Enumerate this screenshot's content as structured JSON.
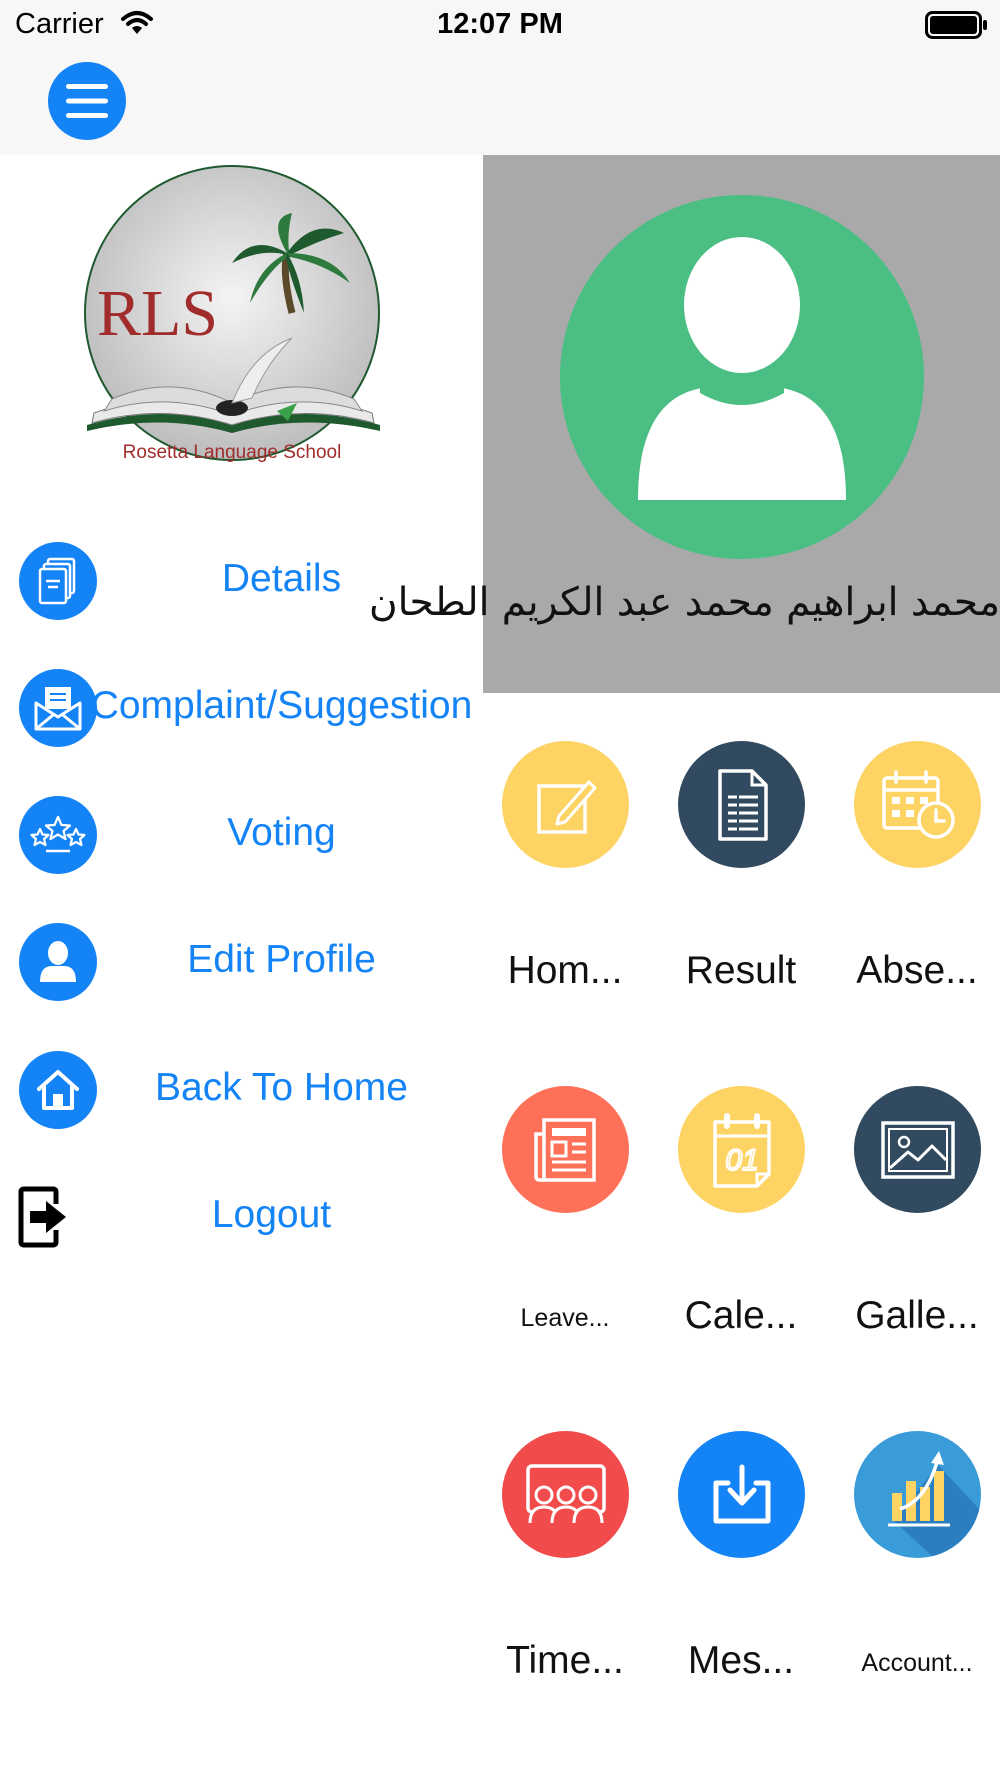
{
  "status_bar": {
    "carrier": "Carrier",
    "time": "12:07 PM"
  },
  "nav": {
    "menu_icon": "hamburger-menu-icon"
  },
  "drawer": {
    "logo": {
      "text_main": "RLS",
      "text_sub": "Rosetta Language School"
    },
    "items": [
      {
        "label": "Details",
        "icon": "document-stack-icon"
      },
      {
        "label": "Complaint/Suggestion",
        "icon": "envelope-icon"
      },
      {
        "label": "Voting",
        "icon": "stars-icon"
      },
      {
        "label": "Edit Profile",
        "icon": "person-icon"
      },
      {
        "label": "Back To Home",
        "icon": "home-icon"
      },
      {
        "label": "Logout",
        "icon": "logout-icon"
      }
    ]
  },
  "profile": {
    "name": "محمد ابراهيم محمد عبد الكريم الطحان",
    "avatar_icon": "user-avatar-icon"
  },
  "tiles": [
    {
      "label": "Hom...",
      "icon": "pencil-note-icon",
      "color": "#fdd363"
    },
    {
      "label": "Result",
      "icon": "report-document-icon",
      "color": "#314a5f"
    },
    {
      "label": "Abse...",
      "icon": "calendar-clock-icon",
      "color": "#fdd363"
    },
    {
      "label": "Leave...",
      "icon": "newspaper-icon",
      "color": "#ff7058"
    },
    {
      "label": "Cale...",
      "icon": "calendar-01-icon",
      "color": "#fdd363"
    },
    {
      "label": "Galle...",
      "icon": "image-gallery-icon",
      "color": "#314a5f"
    },
    {
      "label": "Time...",
      "icon": "classroom-board-icon",
      "color": "#f24b4b"
    },
    {
      "label": "Mes...",
      "icon": "inbox-download-icon",
      "color": "#1483f5"
    },
    {
      "label": "Account...",
      "icon": "bar-chart-growth-icon",
      "color": "#3a9bd9"
    }
  ],
  "colors": {
    "accent": "#1483f5",
    "avatar_bg": "#4bbf83",
    "profile_panel": "#a9a9a9",
    "logo_red": "#a02c2c",
    "logo_green": "#1e5a2e"
  }
}
